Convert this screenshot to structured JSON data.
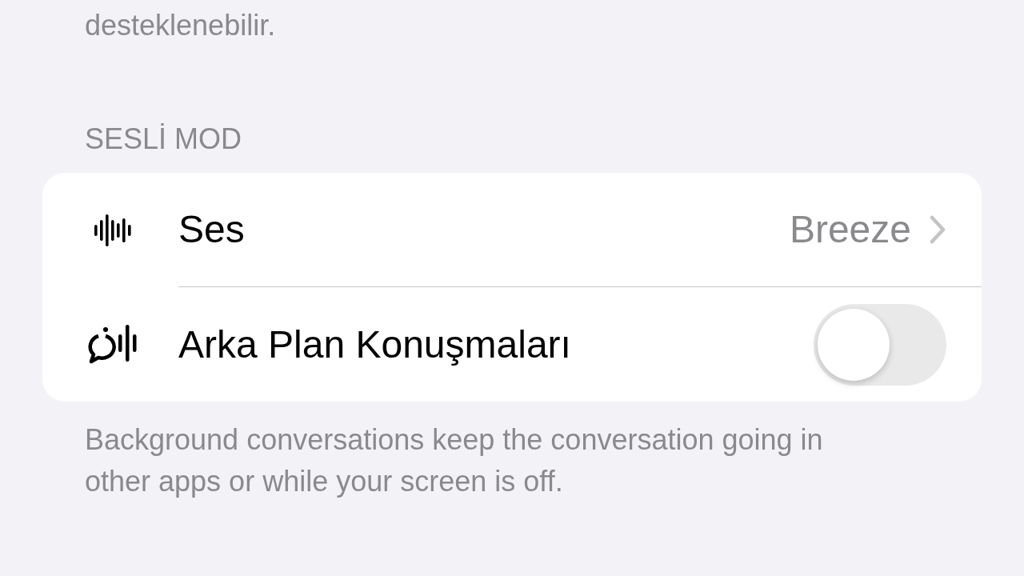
{
  "top_text": "desteklenebilir.",
  "section": {
    "title": "SESLİ MOD",
    "rows": [
      {
        "kind": "link",
        "label": "Ses",
        "value": "Breeze"
      },
      {
        "kind": "toggle",
        "label": "Arka Plan Konuşmaları",
        "on": false
      }
    ],
    "footer": "Background conversations keep the conversation going in other apps or while your screen is off."
  }
}
